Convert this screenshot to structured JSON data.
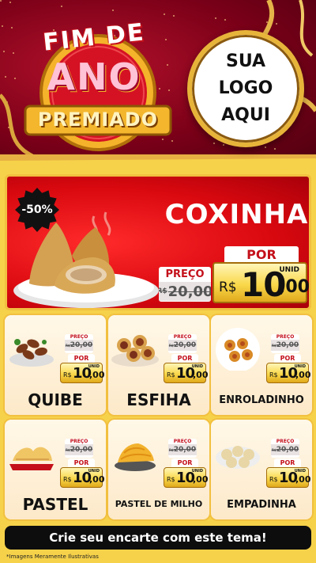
{
  "header": {
    "title_line1": "FIM DE",
    "title_line2": "ANO",
    "title_line3": "PREMIADO",
    "logo_line1": "SUA",
    "logo_line2": "LOGO",
    "logo_line3": "AQUI"
  },
  "hero": {
    "discount": "-50%",
    "name": "COXINHA",
    "price_label": "PREÇO",
    "old_currency": "R$",
    "old_price": "20,00",
    "por_label": "POR",
    "unid": "UNID",
    "currency": "R$",
    "price_int": "10",
    "price_cents": ",00"
  },
  "products": [
    {
      "name": "QUIBE",
      "price_label": "PREÇO",
      "old_currency": "R$",
      "old_price": "20,00",
      "por_label": "POR",
      "unid": "UNID",
      "currency": "R$",
      "price_int": "10",
      "price_cents": ",00"
    },
    {
      "name": "ESFIHA",
      "price_label": "PREÇO",
      "old_currency": "R$",
      "old_price": "20,00",
      "por_label": "POR",
      "unid": "UNID",
      "currency": "R$",
      "price_int": "10",
      "price_cents": ",00"
    },
    {
      "name": "ENROLADINHO",
      "price_label": "PREÇO",
      "old_currency": "R$",
      "old_price": "20,00",
      "por_label": "POR",
      "unid": "UNID",
      "currency": "R$",
      "price_int": "10",
      "price_cents": ",00"
    },
    {
      "name": "PASTEL",
      "price_label": "PREÇO",
      "old_currency": "R$",
      "old_price": "20,00",
      "por_label": "POR",
      "unid": "UNID",
      "currency": "R$",
      "price_int": "10",
      "price_cents": ",00"
    },
    {
      "name": "PASTEL DE MILHO",
      "price_label": "PREÇO",
      "old_currency": "R$",
      "old_price": "20,00",
      "por_label": "POR",
      "unid": "UNID",
      "currency": "R$",
      "price_int": "10",
      "price_cents": ",00"
    },
    {
      "name": "EMPADINHA",
      "price_label": "PREÇO",
      "old_currency": "R$",
      "old_price": "20,00",
      "por_label": "POR",
      "unid": "UNID",
      "currency": "R$",
      "price_int": "10",
      "price_cents": ",00"
    }
  ],
  "footer": {
    "cta": "Crie seu encarte com este tema!",
    "disclaimer": "*Imagens Meramente Ilustrativas"
  },
  "colors": {
    "header_red": "#7a0018",
    "hero_red": "#d8080f",
    "gold": "#f2c040",
    "background_yellow": "#f6d24a",
    "price_red": "#c4101a"
  }
}
